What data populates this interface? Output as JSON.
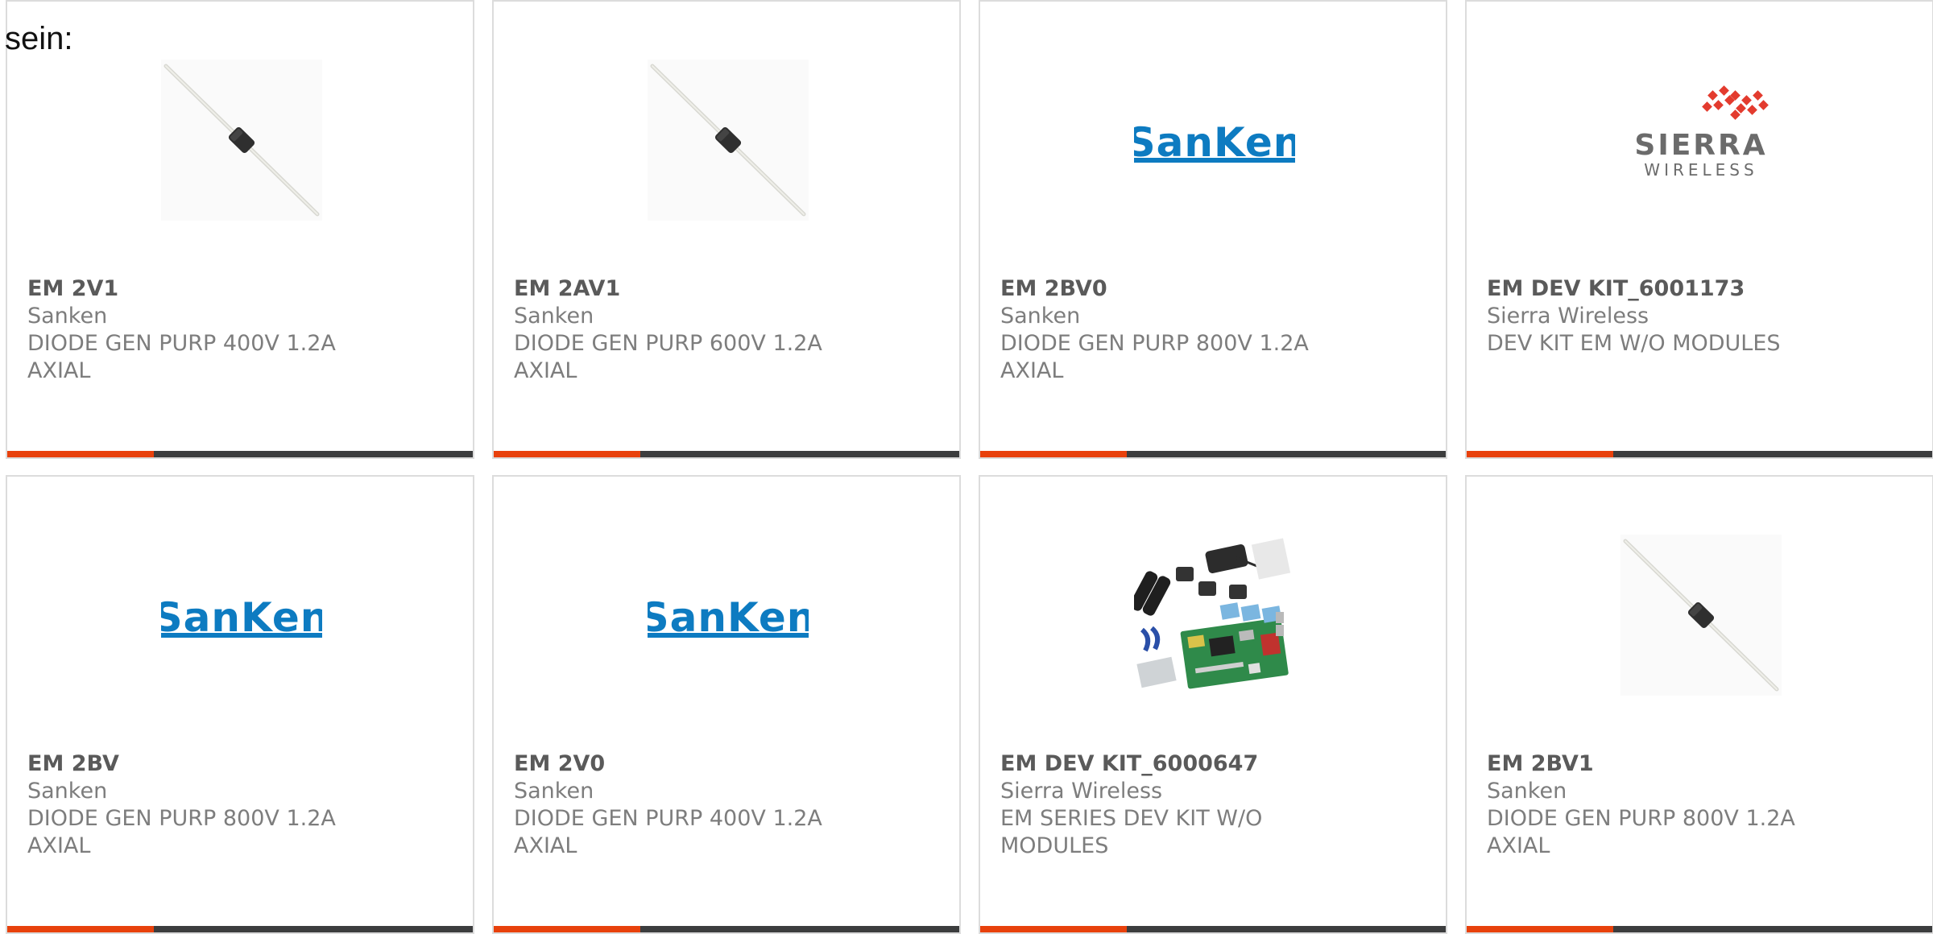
{
  "intro_text": "sein:",
  "colors": {
    "accent": "#e8410c",
    "bar": "#3c3d3e",
    "border": "#dcdcdc",
    "sanken_blue": "#0d7bc1",
    "sierra_red": "#e33b2e"
  },
  "products": [
    {
      "part_number": "EM 2V1",
      "manufacturer": "Sanken",
      "description": "DIODE GEN PURP 400V 1.2A AXIAL",
      "image": "axial-diode-image"
    },
    {
      "part_number": "EM 2AV1",
      "manufacturer": "Sanken",
      "description": "DIODE GEN PURP 600V 1.2A AXIAL",
      "image": "axial-diode-image"
    },
    {
      "part_number": "EM 2BV0",
      "manufacturer": "Sanken",
      "description": "DIODE GEN PURP 800V 1.2A AXIAL",
      "image": "sanken-logo"
    },
    {
      "part_number": "EM DEV KIT_6001173",
      "manufacturer": "Sierra Wireless",
      "description": "DEV KIT EM W/O MODULES",
      "image": "sierra-wireless-logo",
      "logo_text": [
        "SIERRA",
        "WIRELESS"
      ]
    },
    {
      "part_number": "EM 2BV",
      "manufacturer": "Sanken",
      "description": "DIODE GEN PURP 800V 1.2A AXIAL",
      "image": "sanken-logo"
    },
    {
      "part_number": "EM 2V0",
      "manufacturer": "Sanken",
      "description": "DIODE GEN PURP 400V 1.2A AXIAL",
      "image": "sanken-logo"
    },
    {
      "part_number": "EM DEV KIT_6000647",
      "manufacturer": "Sierra Wireless",
      "description": "EM SERIES DEV KIT W/O MODULES",
      "image": "dev-kit-image"
    },
    {
      "part_number": "EM 2BV1",
      "manufacturer": "Sanken",
      "description": "DIODE GEN PURP 800V 1.2A AXIAL",
      "image": "axial-diode-image"
    }
  ]
}
